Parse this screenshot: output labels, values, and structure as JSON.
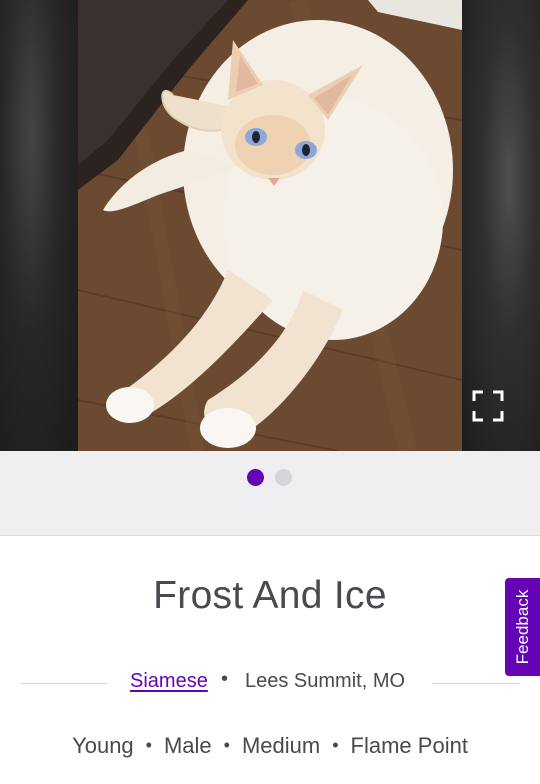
{
  "carousel": {
    "slide_count": 2,
    "active_slide": 1,
    "expand_icon": "expand-icon"
  },
  "pet": {
    "name": "Frost And Ice",
    "breed": "Siamese",
    "location": "Lees Summit, MO",
    "separator": "•",
    "attributes": [
      "Young",
      "Male",
      "Medium",
      "Flame Point"
    ]
  },
  "feedback": {
    "label": "Feedback"
  },
  "colors": {
    "accent": "#6504b5",
    "text": "#4d4751",
    "dots_bg": "#efeff1"
  }
}
